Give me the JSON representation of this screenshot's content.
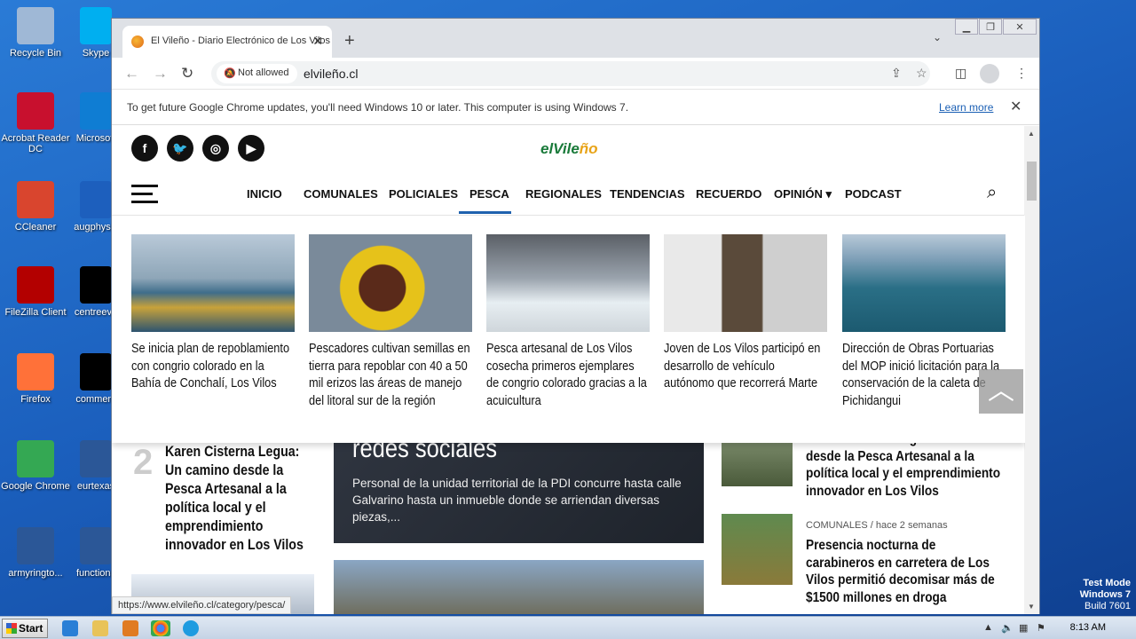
{
  "desktop": {
    "icons": [
      {
        "label": "Recycle Bin",
        "color": "#9fb8d6"
      },
      {
        "label": "Acrobat Reader DC",
        "color": "#c8102e"
      },
      {
        "label": "CCleaner",
        "color": "#d9452e"
      },
      {
        "label": "FileZilla Client",
        "color": "#b30000"
      },
      {
        "label": "Firefox",
        "color": "#ff7139"
      },
      {
        "label": "Google Chrome",
        "color": "#34a853"
      },
      {
        "label": "armyringto...",
        "color": "#2b5797"
      }
    ],
    "icons2": [
      {
        "label": "Skype",
        "color": "#00aff0"
      },
      {
        "label": "Microsoft",
        "color": "#0f7dd3"
      },
      {
        "label": "augphysic",
        "color": "#1d5fbd"
      },
      {
        "label": "centreeve",
        "color": "#000000"
      },
      {
        "label": "comment",
        "color": "#000000"
      },
      {
        "label": "eurtexas",
        "color": "#2b5797"
      },
      {
        "label": "functions",
        "color": "#2b5797"
      }
    ]
  },
  "taskbar": {
    "start_label": "Start",
    "time": "8:13 AM"
  },
  "watermark": {
    "line1": "Test Mode",
    "line2": "Windows 7",
    "line3": "Build 7601"
  },
  "browser": {
    "tab_title": "El Vileño - Diario Electrónico de Los Vilos",
    "security_chip": "Not allowed",
    "url": "elvileño.cl",
    "infobar_message": "To get future Google Chrome updates, you'll need Windows 10 or later. This computer is using Windows 7.",
    "infobar_link": "Learn more",
    "status_url": "https://www.elvileño.cl/category/pesca/"
  },
  "site": {
    "logo_a": "elVile",
    "logo_b": "ño",
    "social": [
      "f",
      "t",
      "ig",
      "yt"
    ],
    "nav": [
      "INICIO",
      "COMUNALES",
      "POLICIALES",
      "PESCA",
      "REGIONALES",
      "TENDENCIAS",
      "RECUERDO",
      "OPINIÓN ▾",
      "PODCAST"
    ],
    "active_nav": "PESCA",
    "accent": "#1f62ae",
    "mega": [
      {
        "title": "Se inicia plan de repoblamiento con congrio colorado en la Bahía de Conchalí, Los Vilos",
        "img": "boat"
      },
      {
        "title": "Pescadores cultivan semillas en tierra para repoblar con 40 a 50 mil erizos las áreas de manejo del litoral sur de la región",
        "img": "urchin"
      },
      {
        "title": "Pesca artesanal de Los Vilos cosecha primeros ejemplares de congrio colorado gracias a la acuicultura",
        "img": "lab"
      },
      {
        "title": "Joven de Los Vilos participó en desarrollo de vehículo autónomo que recorrerá Marte",
        "img": "speaker"
      },
      {
        "title": "Dirección de Obras Portuarias del MOP inició licitación para la conservación de la caleta de Pichidangui",
        "img": "pier"
      }
    ],
    "below": {
      "rank_number": "2",
      "rank_title": "Karen Cisterna Legua: Un camino desde la Pesca Artesanal a la política local y el emprendimiento innovador en Los Vilos",
      "hero_title": "redes sociales",
      "hero_text": "Personal de la unidad territorial de la PDI concurre hasta calle Galvarino hasta un inmueble donde se arriendan diversas piezas,...",
      "side1_title": "Karen Cisterna Legua: Un camino desde la Pesca Artesanal a la política local y el emprendimiento innovador en Los Vilos",
      "side2_cat": "COMUNALES",
      "side2_time": "hace 2 semanas",
      "side2_title": "Presencia nocturna de carabineros en carretera de Los Vilos permitió decomisar más de $1500 millones en droga"
    }
  }
}
